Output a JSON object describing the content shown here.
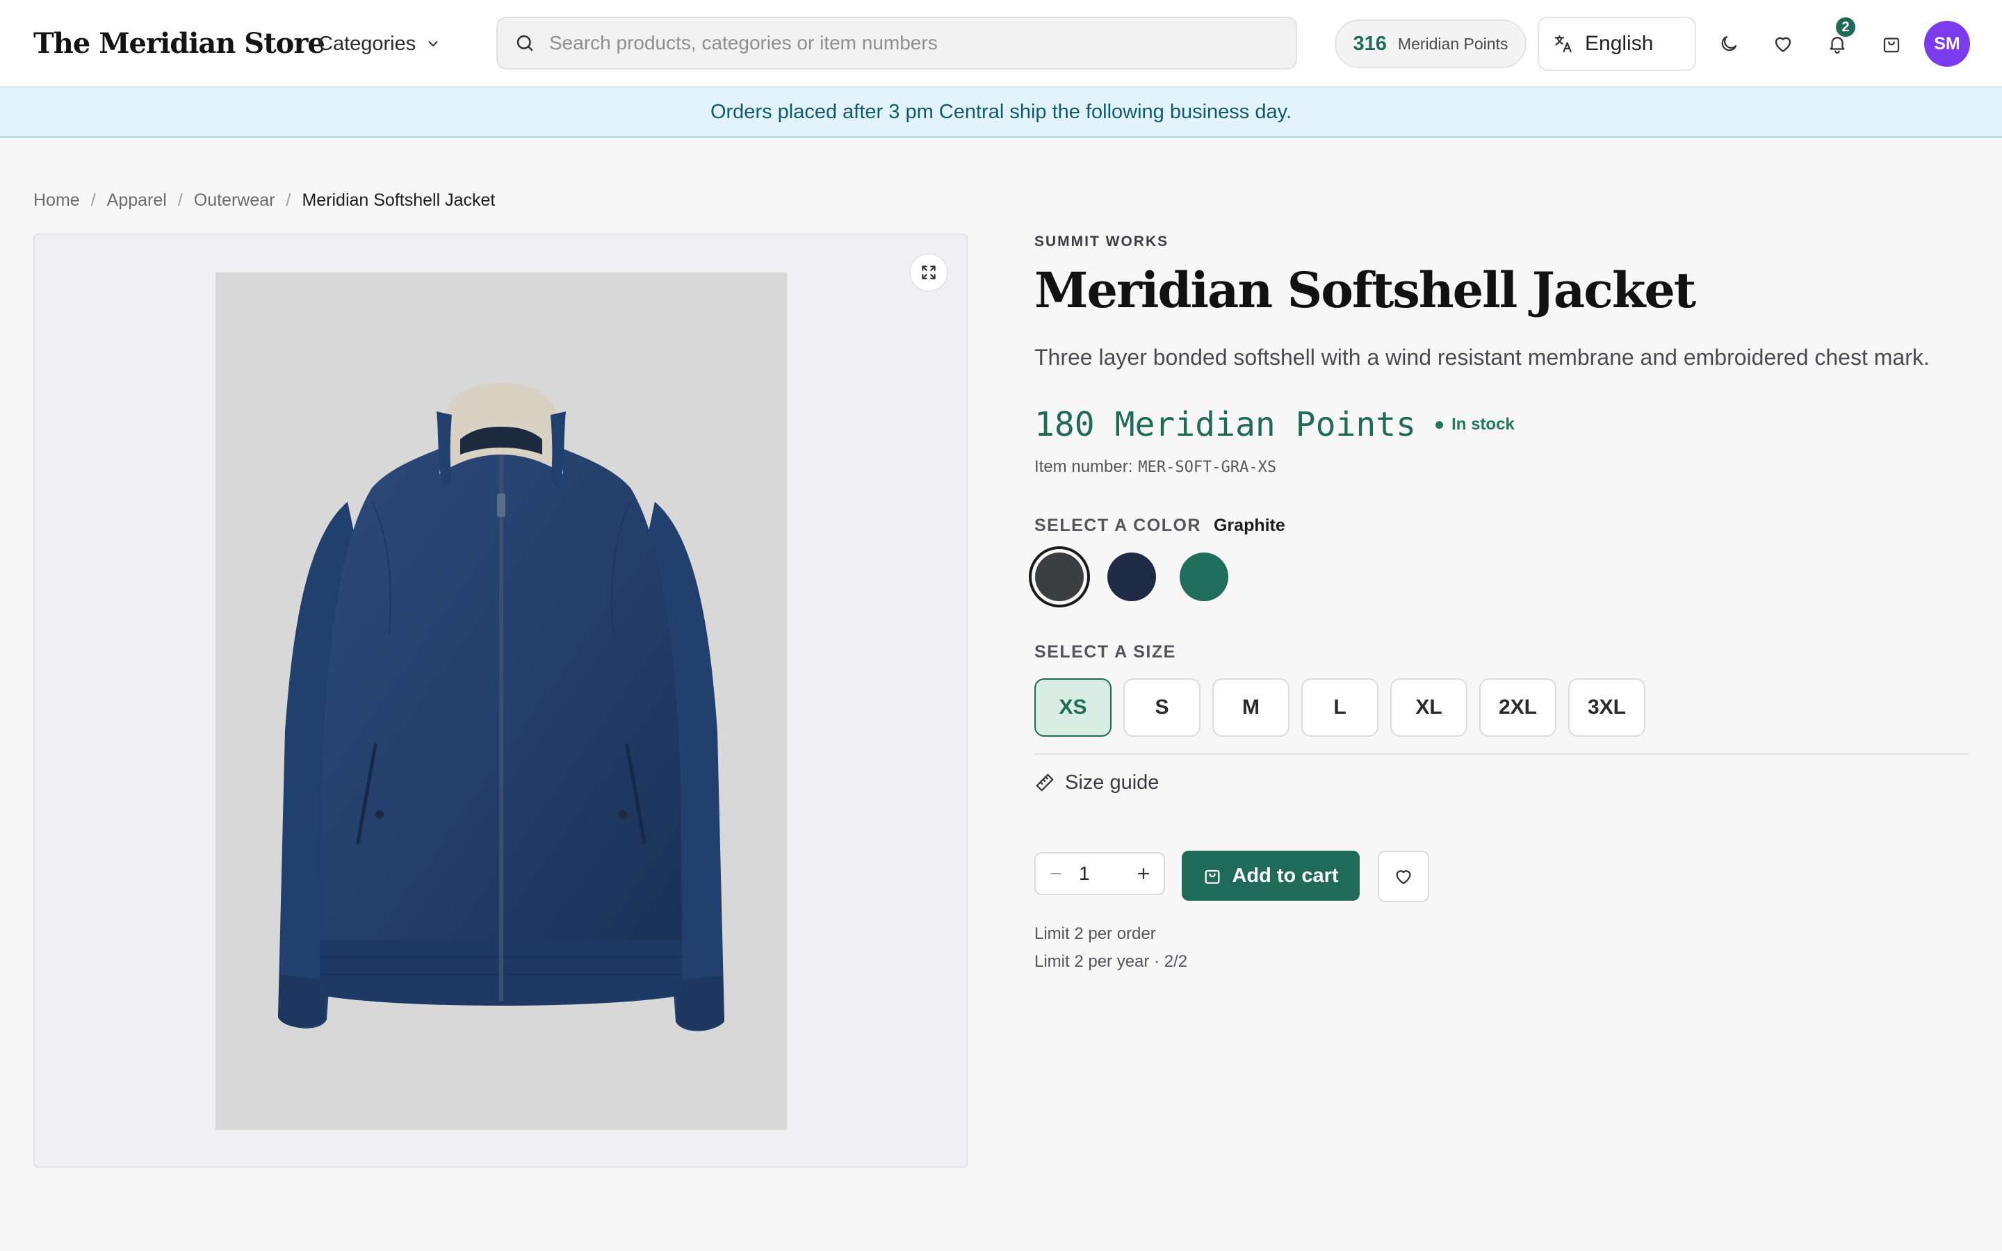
{
  "header": {
    "logo": "The Meridian Store",
    "categories_label": "Categories",
    "search_placeholder": "Search products, categories or item numbers",
    "points_value": "316",
    "points_label": "Meridian Points",
    "language": "English",
    "notifications_count": "2",
    "avatar_initials": "SM",
    "icons": [
      "chevron-down-icon",
      "search-icon",
      "translate-icon",
      "moon-icon",
      "heart-icon",
      "bell-icon",
      "shopping-bag-icon"
    ]
  },
  "banner": {
    "text": "Orders placed after 3 pm Central ship the following business day."
  },
  "breadcrumb": {
    "items": [
      "Home",
      "Apparel",
      "Outerwear"
    ],
    "current": "Meridian Softshell Jacket",
    "separator": "/"
  },
  "product": {
    "brand": "SUMMIT WORKS",
    "title": "Meridian Softshell Jacket",
    "description": "Three layer bonded softshell with a wind resistant membrane and embroidered chest mark.",
    "price": "180 Meridian Points",
    "stock": "In stock",
    "item_number_label": "Item number:",
    "item_number": "MER-SOFT-GRA-XS",
    "color_label": "SELECT A COLOR",
    "selected_color": "Graphite",
    "colors": [
      {
        "name": "Graphite",
        "hex": "#3d3e42",
        "selected": true
      },
      {
        "name": "Navy",
        "hex": "#1f2a44",
        "selected": false
      },
      {
        "name": "Green",
        "hex": "#1e6e5b",
        "selected": false
      }
    ],
    "size_label": "SELECT A SIZE",
    "sizes": [
      "XS",
      "S",
      "M",
      "L",
      "XL",
      "2XL",
      "3XL"
    ],
    "selected_size": "XS",
    "size_guide": "Size guide",
    "quantity": "1",
    "add_to_cart": "Add to cart",
    "limit_order": "Limit 2 per order",
    "limit_year": "Limit 2 per year · 2/2"
  },
  "colors": {
    "accent": "#1f6b57",
    "banner_bg": "#e3f3fb",
    "banner_text": "#0f5a6e",
    "avatar_bg": "#7c3aed"
  }
}
